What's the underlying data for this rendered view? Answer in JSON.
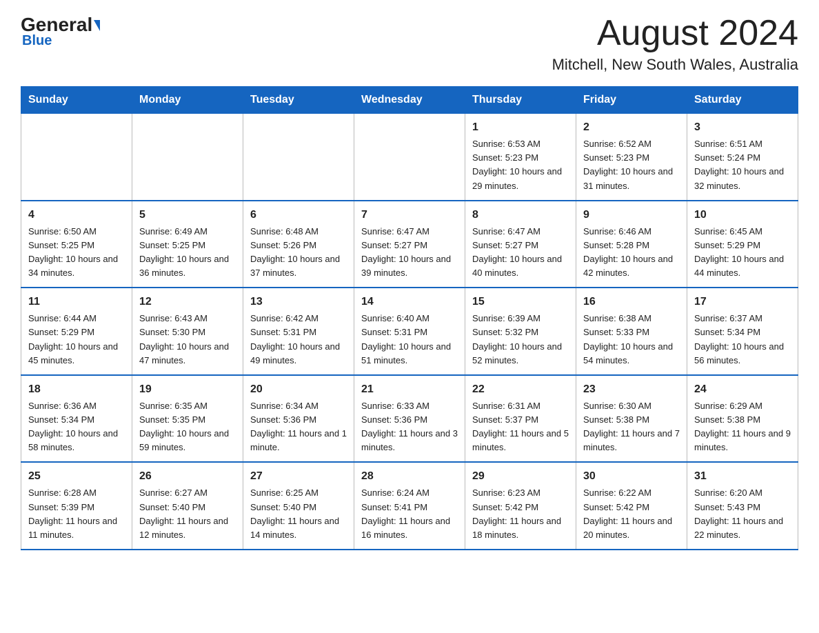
{
  "logo": {
    "general": "General",
    "triangle": "",
    "blue": "Blue"
  },
  "title": {
    "month_year": "August 2024",
    "location": "Mitchell, New South Wales, Australia"
  },
  "days_of_week": [
    "Sunday",
    "Monday",
    "Tuesday",
    "Wednesday",
    "Thursday",
    "Friday",
    "Saturday"
  ],
  "weeks": [
    [
      {
        "day": "",
        "info": ""
      },
      {
        "day": "",
        "info": ""
      },
      {
        "day": "",
        "info": ""
      },
      {
        "day": "",
        "info": ""
      },
      {
        "day": "1",
        "info": "Sunrise: 6:53 AM\nSunset: 5:23 PM\nDaylight: 10 hours and 29 minutes."
      },
      {
        "day": "2",
        "info": "Sunrise: 6:52 AM\nSunset: 5:23 PM\nDaylight: 10 hours and 31 minutes."
      },
      {
        "day": "3",
        "info": "Sunrise: 6:51 AM\nSunset: 5:24 PM\nDaylight: 10 hours and 32 minutes."
      }
    ],
    [
      {
        "day": "4",
        "info": "Sunrise: 6:50 AM\nSunset: 5:25 PM\nDaylight: 10 hours and 34 minutes."
      },
      {
        "day": "5",
        "info": "Sunrise: 6:49 AM\nSunset: 5:25 PM\nDaylight: 10 hours and 36 minutes."
      },
      {
        "day": "6",
        "info": "Sunrise: 6:48 AM\nSunset: 5:26 PM\nDaylight: 10 hours and 37 minutes."
      },
      {
        "day": "7",
        "info": "Sunrise: 6:47 AM\nSunset: 5:27 PM\nDaylight: 10 hours and 39 minutes."
      },
      {
        "day": "8",
        "info": "Sunrise: 6:47 AM\nSunset: 5:27 PM\nDaylight: 10 hours and 40 minutes."
      },
      {
        "day": "9",
        "info": "Sunrise: 6:46 AM\nSunset: 5:28 PM\nDaylight: 10 hours and 42 minutes."
      },
      {
        "day": "10",
        "info": "Sunrise: 6:45 AM\nSunset: 5:29 PM\nDaylight: 10 hours and 44 minutes."
      }
    ],
    [
      {
        "day": "11",
        "info": "Sunrise: 6:44 AM\nSunset: 5:29 PM\nDaylight: 10 hours and 45 minutes."
      },
      {
        "day": "12",
        "info": "Sunrise: 6:43 AM\nSunset: 5:30 PM\nDaylight: 10 hours and 47 minutes."
      },
      {
        "day": "13",
        "info": "Sunrise: 6:42 AM\nSunset: 5:31 PM\nDaylight: 10 hours and 49 minutes."
      },
      {
        "day": "14",
        "info": "Sunrise: 6:40 AM\nSunset: 5:31 PM\nDaylight: 10 hours and 51 minutes."
      },
      {
        "day": "15",
        "info": "Sunrise: 6:39 AM\nSunset: 5:32 PM\nDaylight: 10 hours and 52 minutes."
      },
      {
        "day": "16",
        "info": "Sunrise: 6:38 AM\nSunset: 5:33 PM\nDaylight: 10 hours and 54 minutes."
      },
      {
        "day": "17",
        "info": "Sunrise: 6:37 AM\nSunset: 5:34 PM\nDaylight: 10 hours and 56 minutes."
      }
    ],
    [
      {
        "day": "18",
        "info": "Sunrise: 6:36 AM\nSunset: 5:34 PM\nDaylight: 10 hours and 58 minutes."
      },
      {
        "day": "19",
        "info": "Sunrise: 6:35 AM\nSunset: 5:35 PM\nDaylight: 10 hours and 59 minutes."
      },
      {
        "day": "20",
        "info": "Sunrise: 6:34 AM\nSunset: 5:36 PM\nDaylight: 11 hours and 1 minute."
      },
      {
        "day": "21",
        "info": "Sunrise: 6:33 AM\nSunset: 5:36 PM\nDaylight: 11 hours and 3 minutes."
      },
      {
        "day": "22",
        "info": "Sunrise: 6:31 AM\nSunset: 5:37 PM\nDaylight: 11 hours and 5 minutes."
      },
      {
        "day": "23",
        "info": "Sunrise: 6:30 AM\nSunset: 5:38 PM\nDaylight: 11 hours and 7 minutes."
      },
      {
        "day": "24",
        "info": "Sunrise: 6:29 AM\nSunset: 5:38 PM\nDaylight: 11 hours and 9 minutes."
      }
    ],
    [
      {
        "day": "25",
        "info": "Sunrise: 6:28 AM\nSunset: 5:39 PM\nDaylight: 11 hours and 11 minutes."
      },
      {
        "day": "26",
        "info": "Sunrise: 6:27 AM\nSunset: 5:40 PM\nDaylight: 11 hours and 12 minutes."
      },
      {
        "day": "27",
        "info": "Sunrise: 6:25 AM\nSunset: 5:40 PM\nDaylight: 11 hours and 14 minutes."
      },
      {
        "day": "28",
        "info": "Sunrise: 6:24 AM\nSunset: 5:41 PM\nDaylight: 11 hours and 16 minutes."
      },
      {
        "day": "29",
        "info": "Sunrise: 6:23 AM\nSunset: 5:42 PM\nDaylight: 11 hours and 18 minutes."
      },
      {
        "day": "30",
        "info": "Sunrise: 6:22 AM\nSunset: 5:42 PM\nDaylight: 11 hours and 20 minutes."
      },
      {
        "day": "31",
        "info": "Sunrise: 6:20 AM\nSunset: 5:43 PM\nDaylight: 11 hours and 22 minutes."
      }
    ]
  ]
}
